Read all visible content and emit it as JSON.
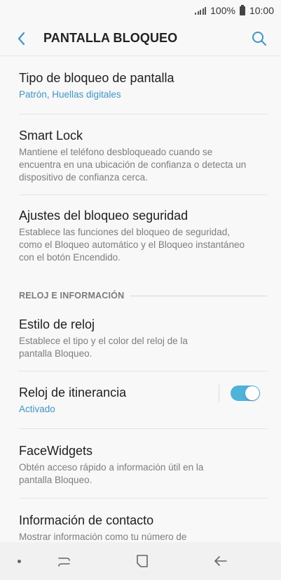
{
  "status_bar": {
    "battery_text": "100%",
    "time": "10:00"
  },
  "header": {
    "title": "PANTALLA BLOQUEO"
  },
  "items": [
    {
      "title": "Tipo de bloqueo de pantalla",
      "subtitle": "Patrón, Huellas digitales"
    },
    {
      "title": "Smart Lock",
      "subtitle_lines": [
        "Mantiene el teléfono desbloqueado cuando se",
        "encuentra en una ubicación de confianza o detecta un",
        "dispositivo de confianza cerca."
      ]
    },
    {
      "title": "Ajustes del bloqueo seguridad",
      "subtitle_lines": [
        "Establece las funciones del bloqueo de seguridad,",
        "como el Bloqueo automático y el Bloqueo instantáneo",
        "con el botón Encendido."
      ]
    }
  ],
  "section": {
    "label": "RELOJ E INFORMACIÓN"
  },
  "items2": [
    {
      "title": "Estilo de reloj",
      "subtitle_lines": [
        "Establece el tipo y el color del reloj de la",
        "pantalla Bloqueo."
      ]
    },
    {
      "title": "Reloj de itinerancia",
      "subtitle": "Activado",
      "toggle_on": true
    },
    {
      "title": "FaceWidgets",
      "subtitle_lines": [
        "Obtén acceso rápido a información útil en la",
        "pantalla Bloqueo."
      ]
    },
    {
      "title": "Información de contacto",
      "subtitle_lines": [
        "Mostrar información como tu número de"
      ]
    }
  ],
  "colors": {
    "accent": "#3e96c1",
    "toggle": "#4fb2d8",
    "background": "#f8f8f8"
  },
  "icons": {
    "back": "chevron-left-icon",
    "search": "search-icon",
    "recents": "recents-icon",
    "home": "home-icon",
    "nav_back": "back-arrow-icon"
  }
}
